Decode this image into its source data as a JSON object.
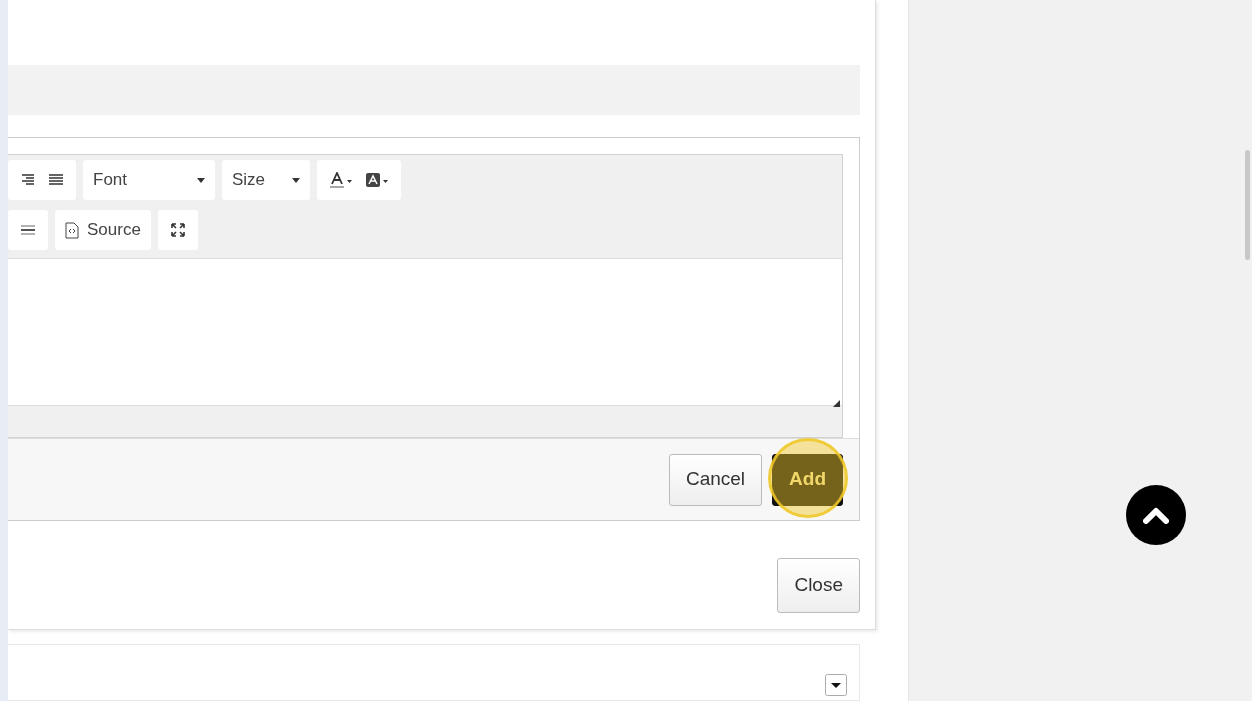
{
  "editor": {
    "toolbar_rows": [
      [
        {
          "kind": "align-group"
        },
        {
          "kind": "combo",
          "label": "Font"
        },
        {
          "kind": "combo",
          "label": "Size"
        },
        {
          "kind": "color-group"
        }
      ],
      [
        {
          "kind": "lines-group"
        },
        {
          "kind": "text-button",
          "label": "Source"
        },
        {
          "kind": "maximize-group"
        }
      ]
    ]
  },
  "form_buttons": [
    {
      "label": "Cancel",
      "primary": false,
      "highlighted": false
    },
    {
      "label": "Add",
      "primary": true,
      "highlighted": true
    }
  ],
  "close_button": {
    "label": "Close"
  }
}
